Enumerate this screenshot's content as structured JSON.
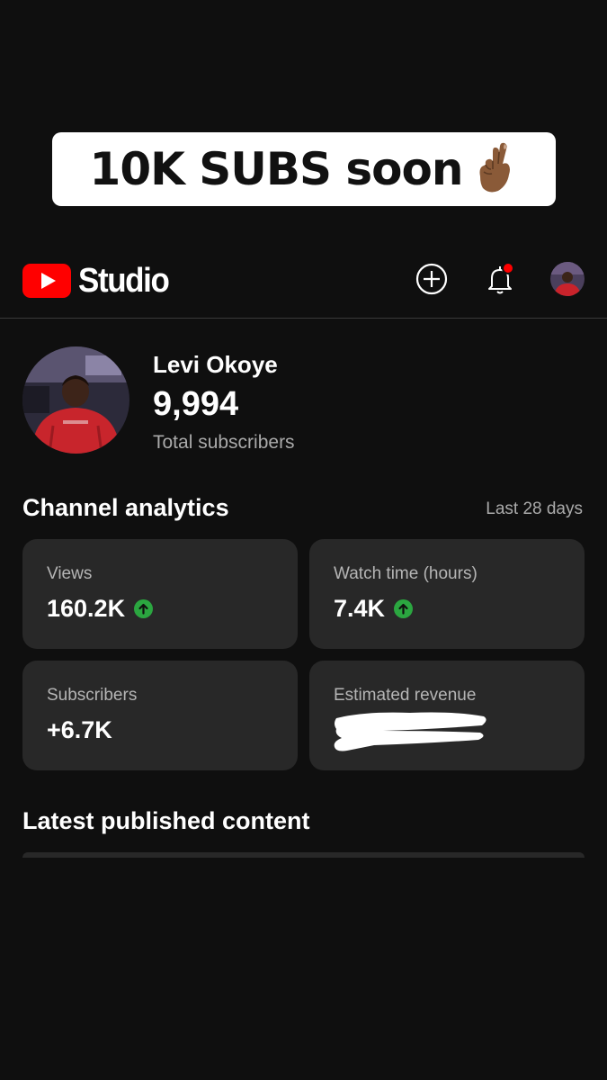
{
  "overlay": {
    "text": "10K SUBS soon",
    "emoji_icon": "crossed-fingers-emoji"
  },
  "header": {
    "logo_icon": "youtube-play-icon",
    "app_name": "Studio",
    "create_icon": "create-plus-icon",
    "notifications_icon": "bell-icon",
    "has_unread_notifications": true
  },
  "channel": {
    "name": "Levi Okoye",
    "subscribers": "9,994",
    "subscribers_label": "Total subscribers"
  },
  "analytics": {
    "title": "Channel analytics",
    "period": "Last 28 days",
    "cards": [
      {
        "label": "Views",
        "value": "160.2K",
        "trend": "up"
      },
      {
        "label": "Watch time (hours)",
        "value": "7.4K",
        "trend": "up"
      },
      {
        "label": "Subscribers",
        "value": "+6.7K",
        "trend": ""
      },
      {
        "label": "Estimated revenue",
        "value": "",
        "redacted": true
      }
    ]
  },
  "latest": {
    "title": "Latest published content"
  },
  "colors": {
    "background": "#0f0f0f",
    "card": "#282828",
    "youtube_red": "#ff0000",
    "trend_green": "#2ba640",
    "muted_text": "#aaaaaa"
  }
}
